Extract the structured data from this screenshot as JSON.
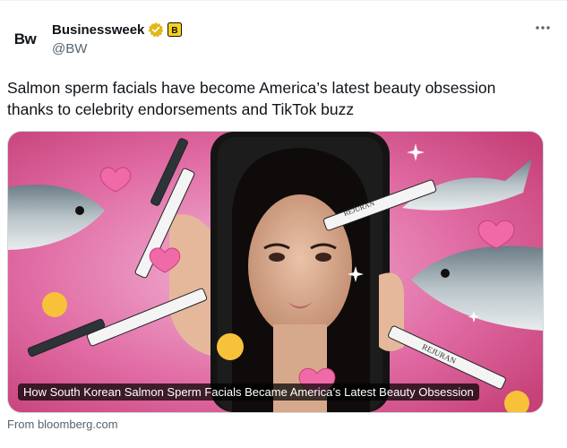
{
  "account": {
    "logo_text": "Bw",
    "display_name": "Businessweek",
    "handle": "@BW",
    "verified_icon": "gold-check-badge-icon",
    "affiliate_badge_text": "B",
    "more_icon": "more-horizontal-icon"
  },
  "tweet": {
    "text": "Salmon sperm facials have become America’s latest beauty obsession thanks to celebrity endorsements and TikTok buzz"
  },
  "card": {
    "image_subject": "woman-face-in-phone-with-syringes-salmon-hearts",
    "syringe_label": "REJURAN",
    "headline": "How South Korean Salmon Sperm Facials Became America’s Latest Beauty Obsession",
    "source": "From bloomberg.com"
  },
  "colors": {
    "verified_gold": "#e2b719",
    "handle_gray": "#536471",
    "card_pink": "#e26fa6"
  }
}
